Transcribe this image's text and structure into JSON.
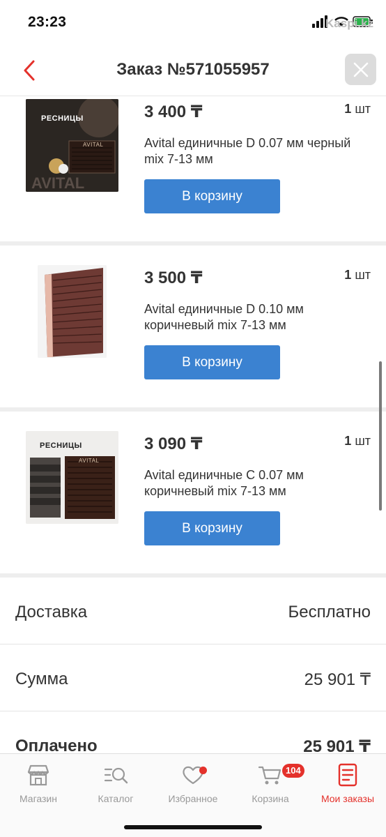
{
  "status_bar": {
    "time": "23:23",
    "watermark": "Kaspi.kz"
  },
  "header": {
    "title": "Заказ №571055957",
    "back_icon": "chevron-left-icon",
    "close_icon": "close-icon"
  },
  "items": [
    {
      "price": "3 400 ₸",
      "qty": "1",
      "qty_unit": "шт",
      "name": "Avital единичные D 0.07 мм черный mix 7-13 мм",
      "button": "В корзину",
      "thumb_label": "РЕСНИЦЫ",
      "thumb_brand": "AVITAL"
    },
    {
      "price": "3 500 ₸",
      "qty": "1",
      "qty_unit": "шт",
      "name": "Avital единичные D 0.10 мм коричневый mix 7-13 мм",
      "button": "В корзину"
    },
    {
      "price": "3 090 ₸",
      "qty": "1",
      "qty_unit": "шт",
      "name": "Avital единичные С 0.07 мм коричневый mix 7-13 мм",
      "button": "В корзину",
      "thumb_label": "РЕСНИЦЫ",
      "thumb_brand": "AVITAL"
    }
  ],
  "summary": {
    "delivery_label": "Доставка",
    "delivery_value": "Бесплатно",
    "sum_label": "Сумма",
    "sum_value": "25 901 ₸",
    "paid_label": "Оплачено",
    "paid_value": "25 901 ₸"
  },
  "tabs": [
    {
      "label": "Магазин",
      "icon": "shop-icon"
    },
    {
      "label": "Каталог",
      "icon": "catalog-search-icon"
    },
    {
      "label": "Избранное",
      "icon": "heart-icon"
    },
    {
      "label": "Корзина",
      "icon": "cart-icon",
      "badge": "104"
    },
    {
      "label": "Мои заказы",
      "icon": "orders-icon"
    }
  ],
  "colors": {
    "accent": "#e4312b",
    "button": "#3b82d1",
    "divider": "#eeeeee"
  }
}
